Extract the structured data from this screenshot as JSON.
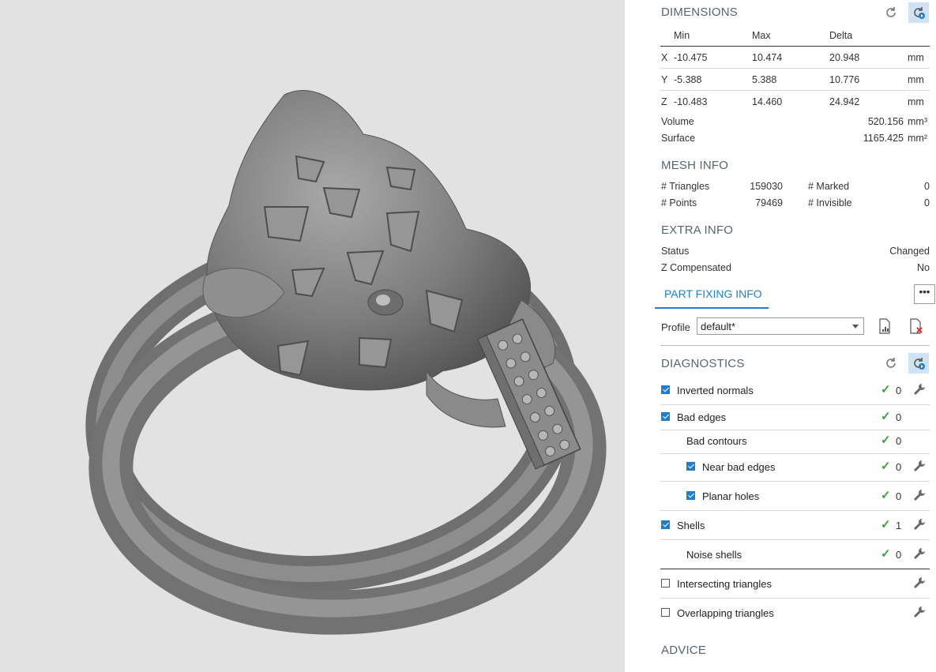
{
  "dimensions": {
    "title": "DIMENSIONS",
    "headers": {
      "min": "Min",
      "max": "Max",
      "delta": "Delta"
    },
    "rows": [
      {
        "axis": "X",
        "min": "-10.475",
        "max": "10.474",
        "delta": "20.948",
        "unit": "mm"
      },
      {
        "axis": "Y",
        "min": "-5.388",
        "max": "5.388",
        "delta": "10.776",
        "unit": "mm"
      },
      {
        "axis": "Z",
        "min": "-10.483",
        "max": "14.460",
        "delta": "24.942",
        "unit": "mm"
      }
    ],
    "volume": {
      "label": "Volume",
      "value": "520.156",
      "unit": "mm³"
    },
    "surface": {
      "label": "Surface",
      "value": "1165.425",
      "unit": "mm²"
    }
  },
  "mesh_info": {
    "title": "MESH INFO",
    "triangles": {
      "label": "# Triangles",
      "value": "159030"
    },
    "points": {
      "label": "# Points",
      "value": "79469"
    },
    "marked": {
      "label": "# Marked",
      "value": "0"
    },
    "invisible": {
      "label": "# Invisible",
      "value": "0"
    }
  },
  "extra_info": {
    "title": "EXTRA INFO",
    "status": {
      "label": "Status",
      "value": "Changed"
    },
    "z_compensated": {
      "label": "Z Compensated",
      "value": "No"
    }
  },
  "part_fixing": {
    "tab_label": "PART FIXING INFO",
    "more_label": "•••",
    "profile_label": "Profile",
    "profile_value": "default*"
  },
  "diagnostics": {
    "title": "DIAGNOSTICS",
    "items": [
      {
        "label": "Inverted normals",
        "count": "0"
      },
      {
        "label": "Bad edges",
        "count": "0"
      },
      {
        "label": "Bad contours",
        "count": "0"
      },
      {
        "label": "Near bad edges",
        "count": "0"
      },
      {
        "label": "Planar holes",
        "count": "0"
      },
      {
        "label": "Shells",
        "count": "1"
      },
      {
        "label": "Noise shells",
        "count": "0"
      },
      {
        "label": "Intersecting triangles"
      },
      {
        "label": "Overlapping triangles"
      }
    ]
  },
  "advice": {
    "title": "ADVICE"
  },
  "colors": {
    "accent": "#1e7fd0",
    "ok_green": "#3aa23a",
    "viewport_bg": "#e2e2e2",
    "model_gray": "#7a7a7a"
  },
  "icons": [
    "refresh-icon",
    "auto-refresh-icon",
    "report-icon",
    "delete-report-icon",
    "check-icon",
    "wrench-icon"
  ]
}
